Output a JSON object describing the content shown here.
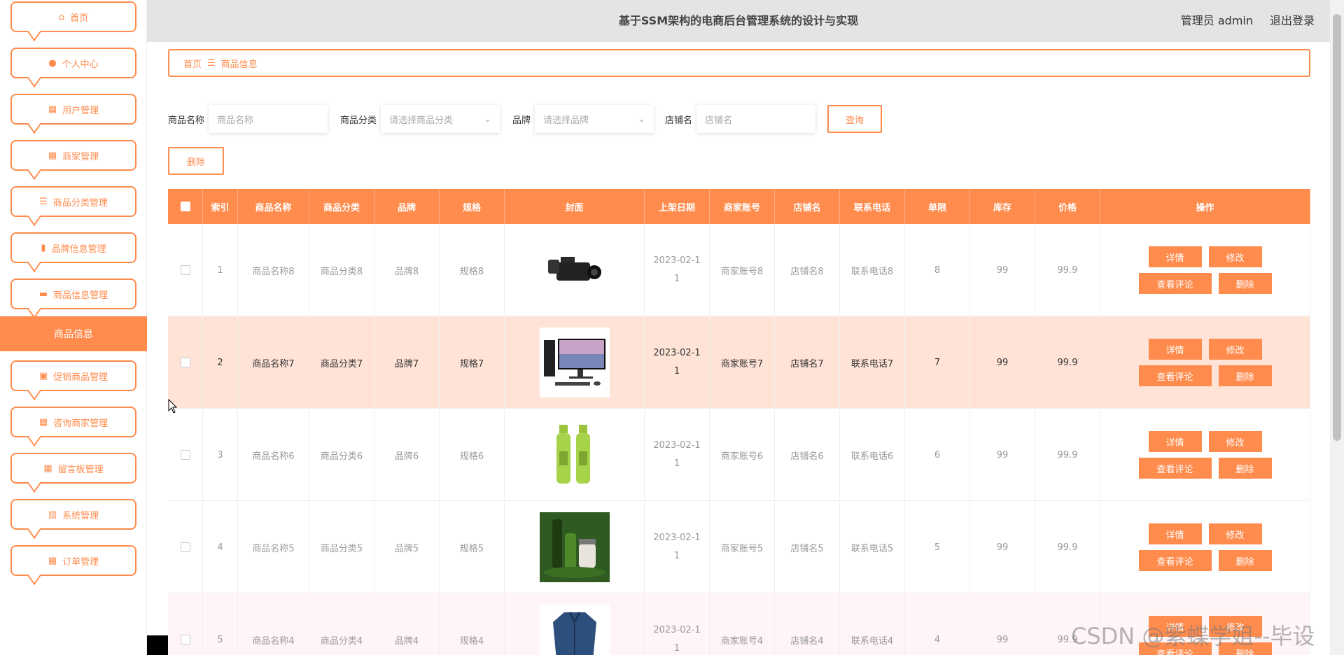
{
  "header": {
    "title": "基于SSM架构的电商后台管理系统的设计与实现",
    "user": "管理员 admin",
    "logout": "退出登录"
  },
  "sidebar": {
    "items": [
      {
        "label": "首页",
        "icon": "home-icon"
      },
      {
        "label": "个人中心",
        "icon": "user-icon"
      },
      {
        "label": "用户管理",
        "icon": "grid-icon"
      },
      {
        "label": "商家管理",
        "icon": "grid-icon"
      },
      {
        "label": "商品分类管理",
        "icon": "list-icon"
      },
      {
        "label": "品牌信息管理",
        "icon": "clipboard-icon"
      },
      {
        "label": "商品信息管理",
        "icon": "monitor-icon"
      },
      {
        "label": "促销商品管理",
        "icon": "clipboard-check-icon"
      },
      {
        "label": "咨询商家管理",
        "icon": "grid-icon"
      },
      {
        "label": "留言板管理",
        "icon": "grid-icon"
      },
      {
        "label": "系统管理",
        "icon": "bar-chart-icon"
      },
      {
        "label": "订单管理",
        "icon": "grid-icon"
      }
    ],
    "active": "商品信息"
  },
  "breadcrumb": {
    "home": "首页",
    "sep": "☰",
    "current": "商品信息"
  },
  "search": {
    "name_label": "商品名称",
    "name_placeholder": "商品名称",
    "category_label": "商品分类",
    "category_placeholder": "请选择商品分类",
    "brand_label": "品牌",
    "brand_placeholder": "请选择品牌",
    "shop_label": "店铺名",
    "shop_placeholder": "店铺名",
    "query": "查询",
    "delete": "删除"
  },
  "table": {
    "columns": [
      "索引",
      "商品名称",
      "商品分类",
      "品牌",
      "规格",
      "封面",
      "上架日期",
      "商家账号",
      "店铺名",
      "联系电话",
      "单限",
      "库存",
      "价格",
      "操作"
    ],
    "ops": {
      "detail": "详情",
      "edit": "修改",
      "comments": "查看评论",
      "delete": "删除"
    },
    "rows": [
      {
        "index": "1",
        "name": "商品名称8",
        "category": "商品分类8",
        "brand": "品牌8",
        "spec": "规格8",
        "cover": "camcorder",
        "date1": "2023-02-1",
        "date2": "1",
        "account": "商家账号8",
        "shop": "店铺名8",
        "phone": "联系电话8",
        "limit": "8",
        "stock": "99",
        "price": "99.9"
      },
      {
        "index": "2",
        "name": "商品名称7",
        "category": "商品分类7",
        "brand": "品牌7",
        "spec": "规格7",
        "cover": "desktop-computer",
        "date1": "2023-02-1",
        "date2": "1",
        "account": "商家账号7",
        "shop": "店铺名7",
        "phone": "联系电话7",
        "limit": "7",
        "stock": "99",
        "price": "99.9"
      },
      {
        "index": "3",
        "name": "商品名称6",
        "category": "商品分类6",
        "brand": "品牌6",
        "spec": "规格6",
        "cover": "green-bottles",
        "date1": "2023-02-1",
        "date2": "1",
        "account": "商家账号6",
        "shop": "店铺名6",
        "phone": "联系电话6",
        "limit": "6",
        "stock": "99",
        "price": "99.9"
      },
      {
        "index": "4",
        "name": "商品名称5",
        "category": "商品分类5",
        "brand": "品牌5",
        "spec": "规格5",
        "cover": "cosmetics-set",
        "date1": "2023-02-1",
        "date2": "1",
        "account": "商家账号5",
        "shop": "店铺名5",
        "phone": "联系电话5",
        "limit": "5",
        "stock": "99",
        "price": "99.9"
      },
      {
        "index": "5",
        "name": "商品名称4",
        "category": "商品分类4",
        "brand": "品牌4",
        "spec": "规格4",
        "cover": "denim-jacket",
        "date1": "2023-02-1",
        "date2": "1",
        "account": "商家账号4",
        "shop": "店铺名4",
        "phone": "联系电话4",
        "limit": "4",
        "stock": "99",
        "price": "99.9"
      }
    ]
  },
  "watermark": "CSDN @紫蝶学姐--毕设",
  "colors": {
    "accent": "#ff8b4d",
    "row_highlight": "#ffe3d7",
    "header_bg": "#e4e4e4"
  }
}
